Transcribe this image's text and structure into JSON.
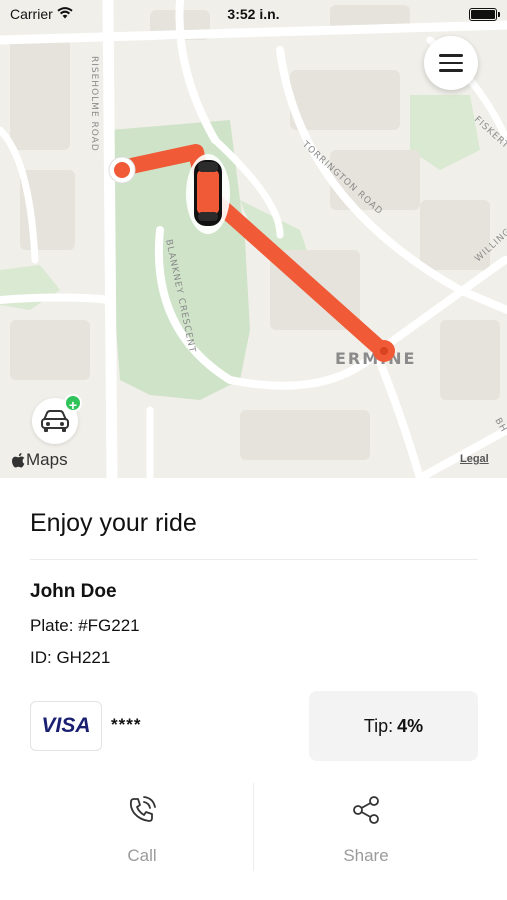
{
  "status_bar": {
    "carrier": "Carrier",
    "time": "3:52 i.n.",
    "icons": [
      "wifi-icon",
      "battery-icon"
    ]
  },
  "map": {
    "road_labels": {
      "risholme": "RISEHOLME ROAD",
      "torrington": "TORRINGTON ROAD",
      "blankney": "BLANKNEY CRESCENT",
      "fiskerton": "FISKERT",
      "willingham": "WILLING",
      "bh": "BH"
    },
    "area_label": "ERMINE",
    "maps_brand": "Maps",
    "legal": "Legal",
    "route_color": "#f05a36",
    "icons": [
      "menu-icon",
      "car-icon",
      "plus-icon",
      "apple-icon"
    ]
  },
  "ride": {
    "title": "Enjoy your ride",
    "driver_name": "John Doe",
    "plate": "Plate: #FG221",
    "id": "ID: GH221",
    "card_brand": "VISA",
    "card_mask": "****",
    "tip_label": "Tip:",
    "tip_value": "4%"
  },
  "actions": {
    "call_label": "Call",
    "share_label": "Share",
    "icons": [
      "phone-icon",
      "share-icon"
    ]
  }
}
